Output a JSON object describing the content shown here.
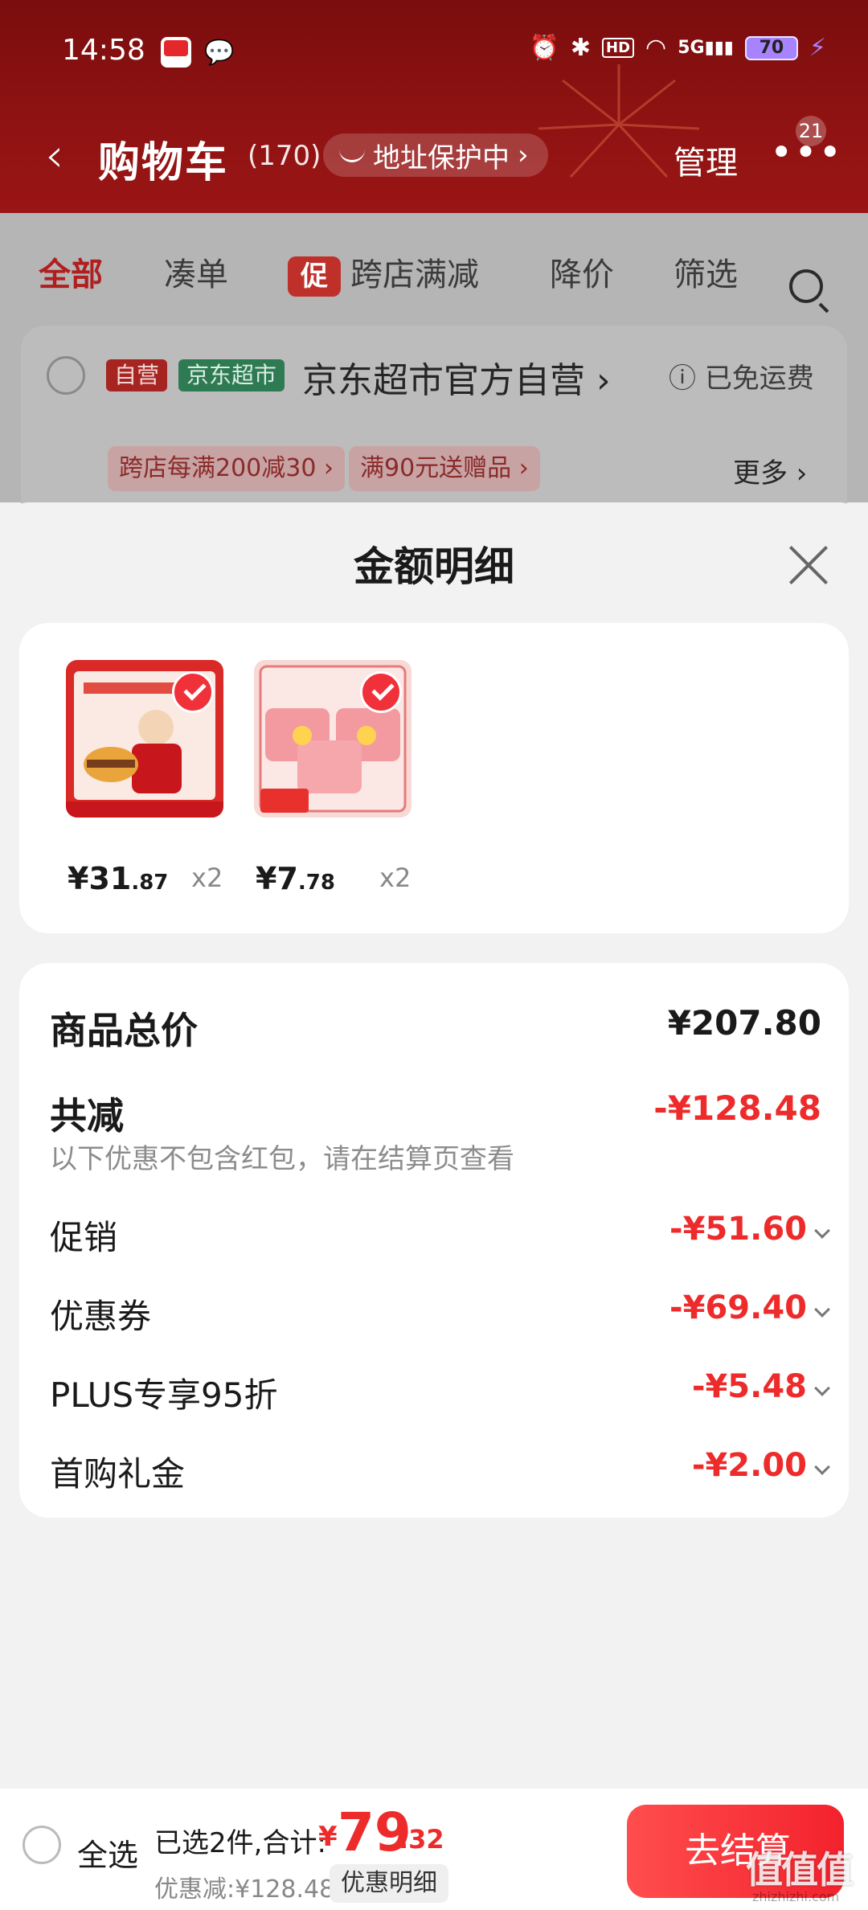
{
  "status_bar": {
    "time": "14:58",
    "battery": "70",
    "hd": "HD",
    "signal": "5G",
    "icons": [
      "jd-app-icon",
      "wechat-icon",
      "alarm-icon",
      "bluetooth-icon",
      "hd-icon",
      "wifi-icon",
      "signal-icon",
      "battery-icon",
      "charging-icon"
    ]
  },
  "header": {
    "title": "购物车",
    "count": "(170)",
    "address_protect": "地址保护中",
    "manage": "管理",
    "more_badge": "21"
  },
  "tabs": [
    {
      "label": "全部",
      "active": true
    },
    {
      "label": "凑单",
      "active": false
    },
    {
      "label": "跨店满减",
      "chip": "促",
      "active": false
    },
    {
      "label": "降价",
      "active": false
    },
    {
      "label": "筛选",
      "active": false
    }
  ],
  "store": {
    "tag_self": "自营",
    "tag_market": "京东超市",
    "name": "京东超市官方自营",
    "shipping": "已免运费",
    "promo1": "跨店每满200减30",
    "promo2": "满90元送赠品",
    "more": "更多"
  },
  "sheet": {
    "title": "金额明细",
    "products": [
      {
        "price_int": "¥31",
        "price_dec": ".87",
        "qty": "x2",
        "image": "burger-promo-image"
      },
      {
        "price_int": "¥7",
        "price_dec": ".78",
        "qty": "x2",
        "image": "laundry-beads-image"
      }
    ],
    "rows": {
      "total_label": "商品总价",
      "total_value": "¥207.80",
      "discount_label": "共减",
      "discount_value": "-¥128.48",
      "note": "以下优惠不包含红包，请在结算页查看",
      "items": [
        {
          "label": "促销",
          "value": "-¥51.60"
        },
        {
          "label": "优惠券",
          "value": "-¥69.40"
        },
        {
          "label": "PLUS专享95折",
          "value": "-¥5.48"
        },
        {
          "label": "首购礼金",
          "value": "-¥2.00"
        }
      ]
    }
  },
  "bottom": {
    "select_all": "全选",
    "summary": "已选2件,合计:",
    "currency": "¥",
    "total_int": "79",
    "total_dec": ".32",
    "saved": "优惠减:¥128.48",
    "detail_button": "优惠明细",
    "checkout": "去结算"
  },
  "watermark": {
    "text": "值值值",
    "sub": "zhizhizhi.com"
  },
  "colors": {
    "header_red": "#8f1212",
    "accent_red": "#ee2b2b",
    "checkout_red": "#f3222d"
  }
}
